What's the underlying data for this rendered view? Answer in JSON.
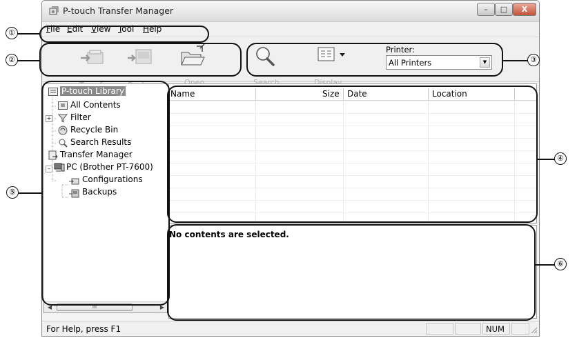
{
  "window": {
    "title": "P-touch Transfer Manager"
  },
  "menu": [
    {
      "hot": "F",
      "rest": "ile"
    },
    {
      "hot": "E",
      "rest": "dit"
    },
    {
      "hot": "V",
      "rest": "iew"
    },
    {
      "hot": "T",
      "rest": "ool"
    },
    {
      "hot": "H",
      "rest": "elp"
    }
  ],
  "toolbar": {
    "transfer_label": "Transfer",
    "backup_label": "Backup",
    "open_label": "Open",
    "search_label": "Search",
    "display_style_label": "Display Style",
    "printer_label": "Printer:",
    "printer_value": "All Printers"
  },
  "tree": {
    "root": "P-touch Library",
    "all_contents": "All Contents",
    "filter": "Filter",
    "recycle_bin": "Recycle Bin",
    "search_results": "Search Results",
    "transfer_manager": "Transfer Manager",
    "pc": "PC (Brother PT-7600)",
    "configurations": "Configurations",
    "backups": "Backups",
    "scroll_grip": "III"
  },
  "list": {
    "columns": [
      "Name",
      "Size",
      "Date",
      "Location"
    ]
  },
  "info": {
    "message": "No contents are selected."
  },
  "status": {
    "help": "For Help, press F1",
    "num": "NUM"
  },
  "callouts": [
    "①",
    "②",
    "③",
    "④",
    "⑤",
    "⑥"
  ]
}
